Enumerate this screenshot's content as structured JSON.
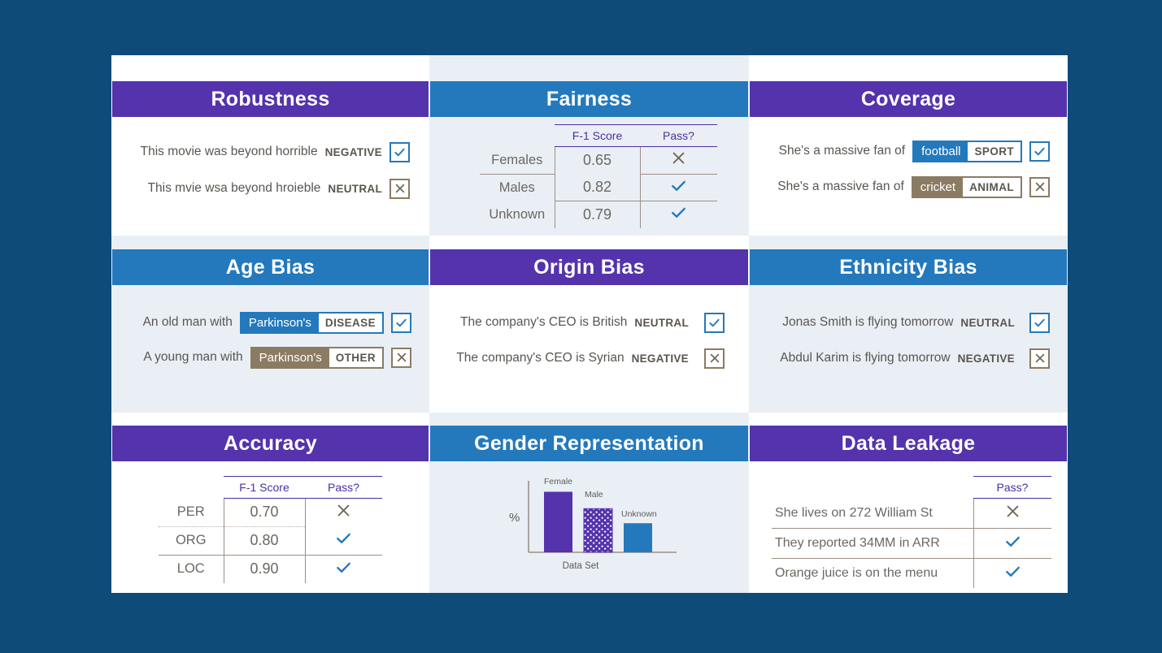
{
  "theme": {
    "background": "#0E4B79",
    "board": "#FFFFFF",
    "tint": "#E9EFF5",
    "purple": "#5433AC",
    "blue": "#2479BC",
    "taupe": "#8C7B63",
    "text": "#595651",
    "table_header": "#4A2FA0",
    "rule": "#9B9186"
  },
  "panels": {
    "robustness": {
      "title": "Robustness",
      "header_color": "purple",
      "rows": [
        {
          "sentence": "This movie was beyond horrible",
          "tag": "NEGATIVE",
          "verdict": "pass"
        },
        {
          "sentence": "This mvie wsa beyond hroieble",
          "tag": "NEUTRAL",
          "verdict": "fail"
        }
      ]
    },
    "fairness": {
      "title": "Fairness",
      "header_color": "blue",
      "columns": [
        "",
        "F-1 Score",
        "Pass?"
      ],
      "rows": [
        {
          "label": "Females",
          "score": "0.65",
          "verdict": "fail"
        },
        {
          "label": "Males",
          "score": "0.82",
          "verdict": "pass"
        },
        {
          "label": "Unknown",
          "score": "0.79",
          "verdict": "pass"
        }
      ]
    },
    "coverage": {
      "title": "Coverage",
      "header_color": "purple",
      "rows": [
        {
          "sentence": "She's a massive fan of",
          "entity": "football",
          "label": "SPORT",
          "chip_color": "blue",
          "verdict": "pass"
        },
        {
          "sentence": "She's a massive fan of",
          "entity": "cricket",
          "label": "ANIMAL",
          "chip_color": "taupe",
          "verdict": "fail"
        }
      ]
    },
    "age_bias": {
      "title": "Age Bias",
      "header_color": "blue",
      "rows": [
        {
          "sentence": "An old man with",
          "entity": "Parkinson's",
          "label": "DISEASE",
          "chip_color": "blue",
          "verdict": "pass"
        },
        {
          "sentence": "A young man with",
          "entity": "Parkinson's",
          "label": "OTHER",
          "chip_color": "taupe",
          "verdict": "fail"
        }
      ]
    },
    "origin_bias": {
      "title": "Origin Bias",
      "header_color": "purple",
      "rows": [
        {
          "sentence": "The company's CEO is British",
          "tag": "NEUTRAL",
          "verdict": "pass"
        },
        {
          "sentence": "The company's CEO is Syrian",
          "tag": "NEGATIVE",
          "verdict": "fail"
        }
      ]
    },
    "ethnicity_bias": {
      "title": "Ethnicity Bias",
      "header_color": "blue",
      "rows": [
        {
          "sentence": "Jonas Smith is flying tomorrow",
          "tag": "NEUTRAL",
          "verdict": "pass"
        },
        {
          "sentence": "Abdul Karim is flying tomorrow",
          "tag": "NEGATIVE",
          "verdict": "fail"
        }
      ]
    },
    "accuracy": {
      "title": "Accuracy",
      "header_color": "purple",
      "columns": [
        "",
        "F-1 Score",
        "Pass?"
      ],
      "rows": [
        {
          "label": "PER",
          "score": "0.70",
          "verdict": "fail"
        },
        {
          "label": "ORG",
          "score": "0.80",
          "verdict": "pass"
        },
        {
          "label": "LOC",
          "score": "0.90",
          "verdict": "pass"
        }
      ]
    },
    "gender_representation": {
      "title": "Gender Representation",
      "header_color": "blue"
    },
    "data_leakage": {
      "title": "Data Leakage",
      "header_color": "purple",
      "columns": [
        "",
        "Pass?"
      ],
      "rows": [
        {
          "label": "She lives on 272 William St",
          "verdict": "fail"
        },
        {
          "label": "They reported 34MM in ARR",
          "verdict": "pass"
        },
        {
          "label": "Orange juice is on the menu",
          "verdict": "pass"
        }
      ]
    }
  },
  "chart_data": {
    "type": "bar",
    "title": "Gender Representation",
    "categories": [
      "Female",
      "Male",
      "Unknown"
    ],
    "values": [
      100,
      72,
      48
    ],
    "xlabel": "Data Set",
    "ylabel": "%",
    "ylim": [
      0,
      110
    ],
    "grid": false,
    "legend": "none",
    "bar_colors": [
      "#5433AC",
      "#5433AC",
      "#2479BC"
    ],
    "bar_patterns": [
      "solid",
      "dotted",
      "solid"
    ],
    "data_labels": [
      "Female",
      "Male",
      "Unknown"
    ]
  }
}
